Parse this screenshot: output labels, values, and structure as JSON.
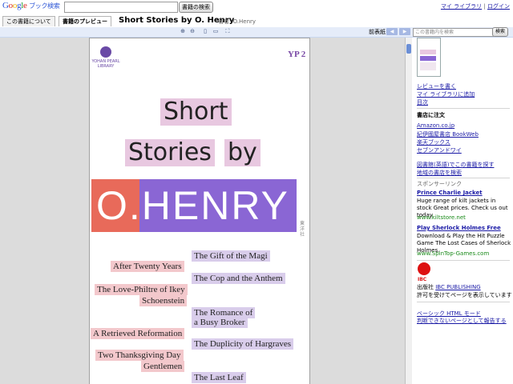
{
  "header": {
    "logo": {
      "g1": "G",
      "g2": "o",
      "g3": "o",
      "g4": "g",
      "g5": "l",
      "g6": "e",
      "sub": "ブック検索"
    },
    "search": {
      "value": "",
      "button_label": "書籍の検索"
    },
    "user_links": {
      "library": "マイ ライブラリ",
      "separator": "|",
      "logout": "ログイン"
    }
  },
  "tabs": {
    "about": "この書籍について",
    "preview": "書籍のプレビュー"
  },
  "book": {
    "title": "Short Stories by O. Henry",
    "author": "著者: O.Henry"
  },
  "toolbar": {
    "icons": [
      "zoom-in-icon",
      "zoom-out-icon",
      "single-page-icon",
      "two-page-icon",
      "fullscreen-icon"
    ],
    "zoom_in_glyph": "⊕",
    "zoom_out_glyph": "⊖",
    "single_page_glyph": "▯",
    "two_page_glyph": "▭",
    "fullscreen_glyph": "⛶",
    "cover_label": "前表紙",
    "prev_glyph": "◀",
    "next_glyph": "▶",
    "inbook_search_placeholder": "この書籍内を検索",
    "inbook_search_button": "検索"
  },
  "cover": {
    "publisher_logo_text": "YOHAN PEARL LIBRARY",
    "series_badge": "YP 2",
    "title_line1": "Short",
    "title_line2a": "Stories",
    "title_line2b": "by",
    "author_big": "O.HENRY",
    "vertical_note": "東洋社",
    "stories_left": [
      "After Twenty Years",
      "The Love-Philtre of Ikey",
      "Schoenstein",
      "A Retrieved Reformation",
      "Two Thanksgiving Day",
      "Gentlemen"
    ],
    "stories_right": [
      "The Gift of the Magi",
      "The Cop and the Anthem",
      "The Romance of",
      "a Busy Broker",
      "The Duplicity of Hargraves",
      "The Last Leaf"
    ]
  },
  "sidebar": {
    "links": [
      "レビューを書く",
      "マイ ライブラリに追加",
      "目次"
    ],
    "buy_heading": "書店に注文",
    "stores": [
      "Amazon.co.jp",
      "紀伊國屋書店 BookWeb",
      "楽天ブックス",
      "セブンアンドワイ"
    ],
    "library_links": [
      "図書館(英語)でこの書籍を探す",
      "地域の書店を検索"
    ],
    "sponsored_heading": "スポンサーリンク",
    "ads": [
      {
        "title": "Prince Charlie Jacket",
        "body": "Huge range of kilt jackets in stock Great prices. Check us out today.",
        "url": "www.kiltstore.net"
      },
      {
        "title": "Play Sherlock Holmes Free",
        "body": "Download & Play the Hit Puzzle Game The Lost Cases of Sherlock Holmes.",
        "url": "www.SpinTop-Games.com"
      }
    ],
    "publisher_logo_label": "IBC",
    "publisher_prefix": "出版社",
    "publisher_name": "IBC PUBLISHING",
    "permission_note": "許可を受けてページを表示しています",
    "basic_html_mode": "ベーシック HTML モード",
    "report_problem": "判断できないページとして報告する"
  },
  "colors": {
    "toolbar_bg": "#e5ecf9",
    "link": "#1a1aa6",
    "henry_purple": "#8a66d4",
    "henry_orange": "#e86a5a",
    "title_pink": "#e8c8e0",
    "story_pink": "#f3c8cc",
    "story_lavender": "#d9cdeb"
  }
}
